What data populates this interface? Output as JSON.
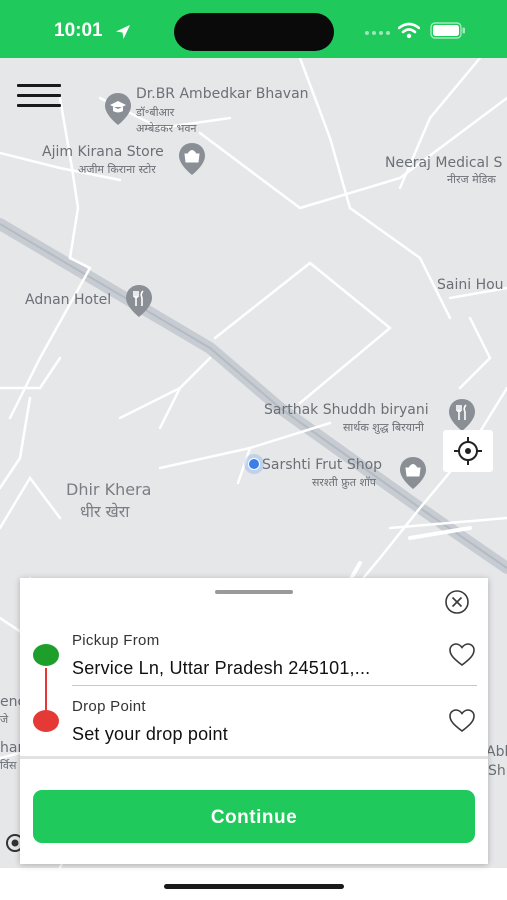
{
  "status_bar": {
    "time": "10:01"
  },
  "map": {
    "labels": {
      "ambedkar_en": "Dr.BR Ambedkar Bhavan",
      "ambedkar_hi_1": "डॉ॰बीआर",
      "ambedkar_hi_2": "अम्बेडकर भवन",
      "ajim_en": "Ajim Kirana Store",
      "ajim_hi": "अजीम किराना स्टोर",
      "neeraj_en": "Neeraj Medical S",
      "neeraj_hi": "नीरज मेडिक",
      "saini_en": "Saini Hou",
      "adnan_en": "Adnan Hotel",
      "sarthak_en": "Sarthak Shuddh biryani",
      "sarthak_hi": "सार्थक शुद्ध बिरयानी",
      "sarshti_en": "Sarshti Frut Shop",
      "sarshti_hi": "सरश्ती फ्रुत शॉप",
      "dhir_en": "Dhir Khera",
      "dhir_hi": "धीर खेरा",
      "left_edge_1": "ence",
      "left_edge_2": "जे",
      "left_edge_3": "har",
      "left_edge_4": "र्विस",
      "right_edge_1": "Abh",
      "right_edge_2": "Sh"
    }
  },
  "booking": {
    "pickup_title": "Pickup From",
    "pickup_value": "Service Ln, Uttar Pradesh 245101,...",
    "drop_title": "Drop Point",
    "drop_value": "Set your drop point",
    "continue_label": "Continue"
  },
  "icons": {
    "menu": "hamburger-icon",
    "locate": "crosshair-icon",
    "close": "close-circle-icon",
    "favorite": "heart-outline-icon",
    "pickup_pin": "green-dot",
    "drop_pin": "red-dot"
  },
  "colors": {
    "brand_green": "#1fc95b",
    "pickup_pin": "#1e9e2a",
    "drop_pin": "#e53935",
    "map_background": "#e6e7e9",
    "user_location": "#3b7de9"
  }
}
